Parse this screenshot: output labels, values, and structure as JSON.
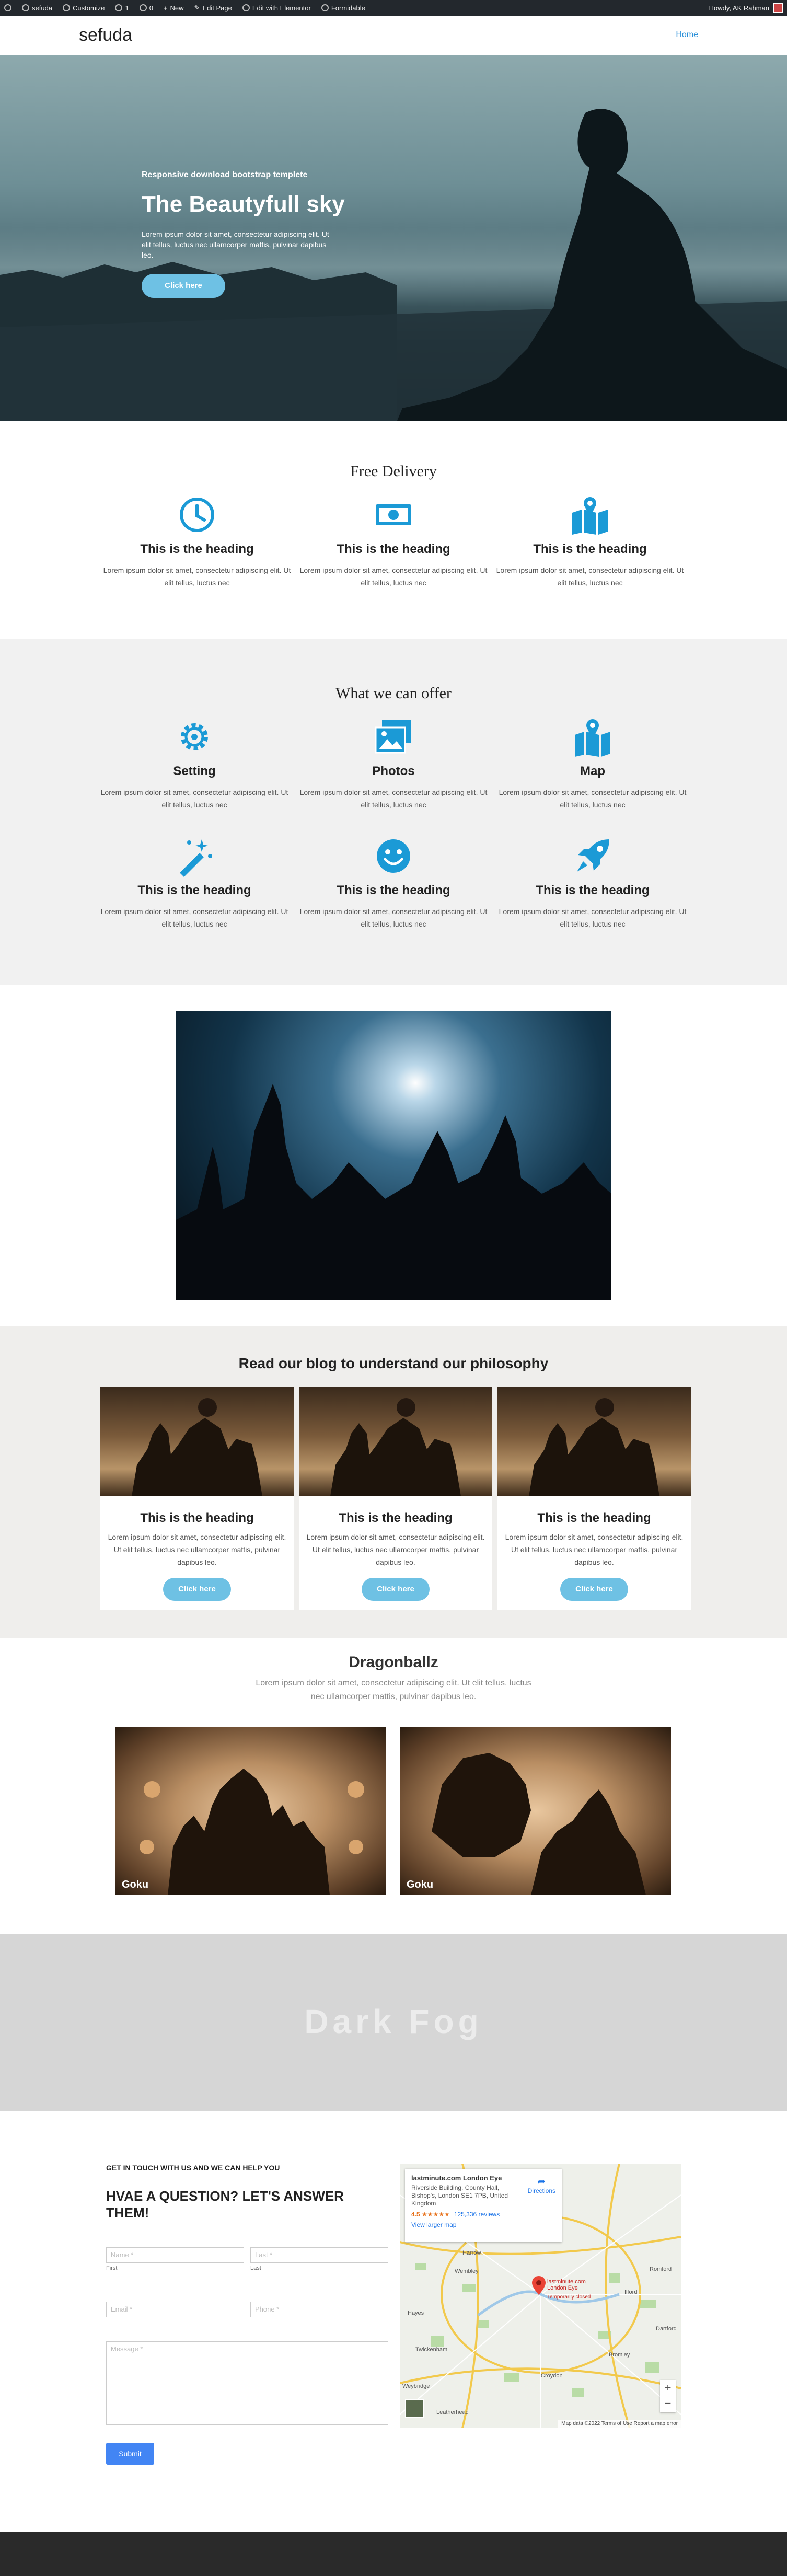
{
  "admin_bar": {
    "items": [
      "sefuda",
      "Customize",
      "1",
      "0",
      "New",
      "Edit Page",
      "Edit with Elementor",
      "Formidable"
    ],
    "greeting": "Howdy, AK Rahman"
  },
  "header": {
    "site_title": "sefuda",
    "nav": [
      "Home"
    ]
  },
  "hero": {
    "kicker": "Responsive download bootstrap templete",
    "title": "The Beautyfull sky",
    "description": "Lorem ipsum dolor sit amet, consectetur adipiscing elit. Ut elit tellus, luctus nec ullamcorper mattis, pulvinar dapibus leo.",
    "button": "Click here"
  },
  "delivery": {
    "title": "Free Delivery",
    "features": [
      {
        "icon": "clock-icon",
        "heading": "This is the heading",
        "text": "Lorem ipsum dolor sit amet, consectetur adipiscing elit. Ut elit tellus, luctus nec"
      },
      {
        "icon": "money-bill-icon",
        "heading": "This is the heading",
        "text": "Lorem ipsum dolor sit amet, consectetur adipiscing elit. Ut elit tellus, luctus nec"
      },
      {
        "icon": "map-marked-icon",
        "heading": "This is the heading",
        "text": "Lorem ipsum dolor sit amet, consectetur adipiscing elit. Ut elit tellus, luctus nec"
      }
    ]
  },
  "offer": {
    "title": "What we can offer",
    "features": [
      {
        "icon": "gear-icon",
        "heading": "Setting",
        "text": "Lorem ipsum dolor sit amet, consectetur adipiscing elit. Ut elit tellus, luctus nec"
      },
      {
        "icon": "photos-icon",
        "heading": "Photos",
        "text": "Lorem ipsum dolor sit amet, consectetur adipiscing elit. Ut elit tellus, luctus nec"
      },
      {
        "icon": "map-icon",
        "heading": "Map",
        "text": "Lorem ipsum dolor sit amet, consectetur adipiscing elit. Ut elit tellus, luctus nec"
      },
      {
        "icon": "magic-wand-icon",
        "heading": "This is the heading",
        "text": "Lorem ipsum dolor sit amet, consectetur adipiscing elit. Ut elit tellus, luctus nec"
      },
      {
        "icon": "smiley-icon",
        "heading": "This is the heading",
        "text": "Lorem ipsum dolor sit amet, consectetur adipiscing elit. Ut elit tellus, luctus nec"
      },
      {
        "icon": "rocket-icon",
        "heading": "This is the heading",
        "text": "Lorem ipsum dolor sit amet, consectetur adipiscing elit. Ut elit tellus, luctus nec"
      }
    ]
  },
  "blog": {
    "title": "Read our blog to understand our philosophy",
    "cards": [
      {
        "heading": "This is the heading",
        "text": "Lorem ipsum dolor sit amet, consectetur adipiscing elit. Ut elit tellus, luctus nec ullamcorper mattis, pulvinar dapibus leo.",
        "button": "Click here"
      },
      {
        "heading": "This is the heading",
        "text": "Lorem ipsum dolor sit amet, consectetur adipiscing elit. Ut elit tellus, luctus nec ullamcorper mattis, pulvinar dapibus leo.",
        "button": "Click here"
      },
      {
        "heading": "This is the heading",
        "text": "Lorem ipsum dolor sit amet, consectetur adipiscing elit. Ut elit tellus, luctus nec ullamcorper mattis, pulvinar dapibus leo.",
        "button": "Click here"
      }
    ]
  },
  "dragon": {
    "title": "Dragonballz",
    "description": "Lorem ipsum dolor sit amet, consectetur adipiscing elit. Ut elit tellus, luctus nec ullamcorper mattis, pulvinar dapibus leo.",
    "items": [
      {
        "label": "Goku"
      },
      {
        "label": "Goku"
      }
    ]
  },
  "fog": {
    "title": "Dark Fog"
  },
  "contact": {
    "kicker": "GET IN TOUCH WITH US AND WE CAN HELP YOU",
    "title": "HVAE A QUESTION? LET'S ANSWER THEM!",
    "first_placeholder": "Name *",
    "first_sub": "First",
    "last_placeholder": "Last *",
    "last_sub": "Last",
    "email_placeholder": "Email *",
    "phone_placeholder": "Phone *",
    "message_placeholder": "Message *",
    "submit": "Submit"
  },
  "map": {
    "place": "lastminute.com London Eye",
    "address": "Riverside Building, County Hall, Bishop's, London SE1 7PB, United Kingdom",
    "rating": "4.5 ★★★★★",
    "reviews": "125,336 reviews",
    "view_larger": "View larger map",
    "directions": "Directions",
    "pin_label": "lastminute.com London Eye",
    "pin_sub": "Temporarily closed",
    "places": [
      "Harrow",
      "Wembley",
      "Romford",
      "Hayes",
      "Ilford",
      "Twickenham",
      "Dartford",
      "Croydon",
      "Bromley",
      "Leatherhead",
      "Weybridge"
    ],
    "footer": "Map data ©2022   Terms of Use   Report a map error"
  },
  "colors": {
    "accent": "#1b9ad6",
    "button": "#6ec1e4",
    "submit": "#4285f4",
    "admin_bar": "#23282d"
  }
}
